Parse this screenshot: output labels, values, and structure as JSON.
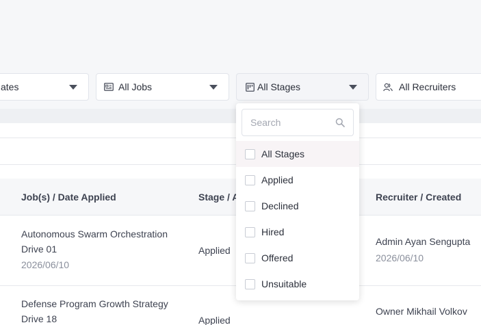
{
  "filters": {
    "candidates_label": "ates",
    "jobs_label": "All Jobs",
    "stages_label": "All Stages",
    "recruiters_label": "All Recruiters"
  },
  "table": {
    "headers": [
      "Job(s) / Date Applied",
      "Stage / A",
      "Recruiter / Created"
    ],
    "rows": [
      {
        "job_line1": "Autonomous Swarm Orchestration",
        "job_line2": "Drive 01",
        "date_applied": "2026/06/10",
        "stage": "Applied",
        "recruiter": "Admin Ayan Sengupta",
        "created": "2026/06/10"
      },
      {
        "job_line1": "Defense Program Growth Strategy",
        "job_line2": "Drive 18",
        "stage": "Applied",
        "recruiter": "Owner Mikhail Volkov"
      }
    ]
  },
  "stage_dropdown": {
    "search_placeholder": "Search",
    "options": [
      "All Stages",
      "Applied",
      "Declined",
      "Hired",
      "Offered",
      "Unsuitable"
    ],
    "highlighted_index": 0
  },
  "icons": {
    "jobs": "id-card-icon",
    "stages": "kanban-icon",
    "recruiters": "users-icon",
    "caret": "caret-down-icon",
    "search": "search-icon"
  }
}
